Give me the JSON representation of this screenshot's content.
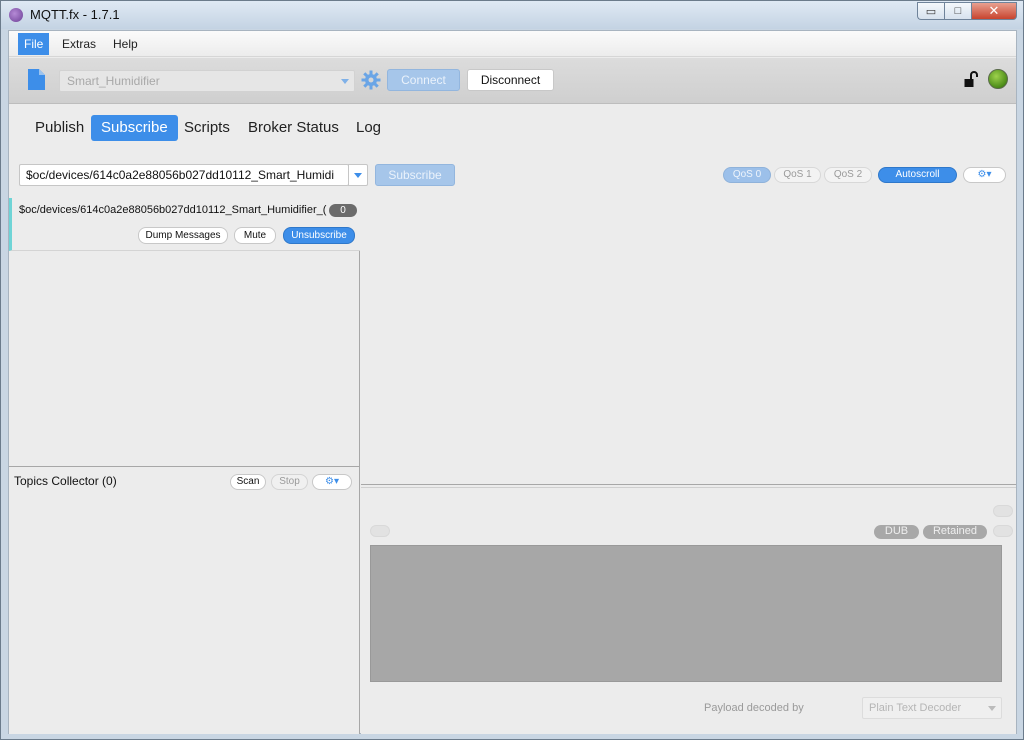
{
  "window": {
    "title": "MQTT.fx - 1.7.1",
    "minimize": "▭",
    "restore": "□",
    "close": "✕"
  },
  "menu": {
    "items": [
      {
        "label": "File"
      },
      {
        "label": "Extras"
      },
      {
        "label": "Help"
      }
    ]
  },
  "toolbar": {
    "profile": "Smart_Humidifier",
    "connect_label": "Connect",
    "disconnect_label": "Disconnect"
  },
  "tabs": [
    {
      "label": "Publish"
    },
    {
      "label": "Subscribe"
    },
    {
      "label": "Scripts"
    },
    {
      "label": "Broker Status"
    },
    {
      "label": "Log"
    }
  ],
  "subscribe": {
    "topic_value": "$oc/devices/614c0a2e88056b027dd10112_Smart_Humidi",
    "subscribe_label": "Subscribe",
    "qos": [
      "QoS 0",
      "QoS 1",
      "QoS 2"
    ],
    "autoscroll_label": "Autoscroll",
    "options_label": "⚙▾"
  },
  "subscription": {
    "topic": "$oc/devices/614c0a2e88056b027dd10112_Smart_Humidifier_(",
    "count": "0",
    "dump_label": "Dump Messages",
    "mute_label": "Mute",
    "unsubscribe_label": "Unsubscribe"
  },
  "collector": {
    "title": "Topics Collector (0)",
    "scan_label": "Scan",
    "stop_label": "Stop",
    "options_label": "⚙▾"
  },
  "detail": {
    "dub_label": "DUB",
    "retained_label": "Retained",
    "payload_decoded_label": "Payload decoded by",
    "decoder": "Plain Text Decoder"
  },
  "colors": {
    "accent": "#3d8ee9",
    "status_connected": "#6aaa2a"
  }
}
